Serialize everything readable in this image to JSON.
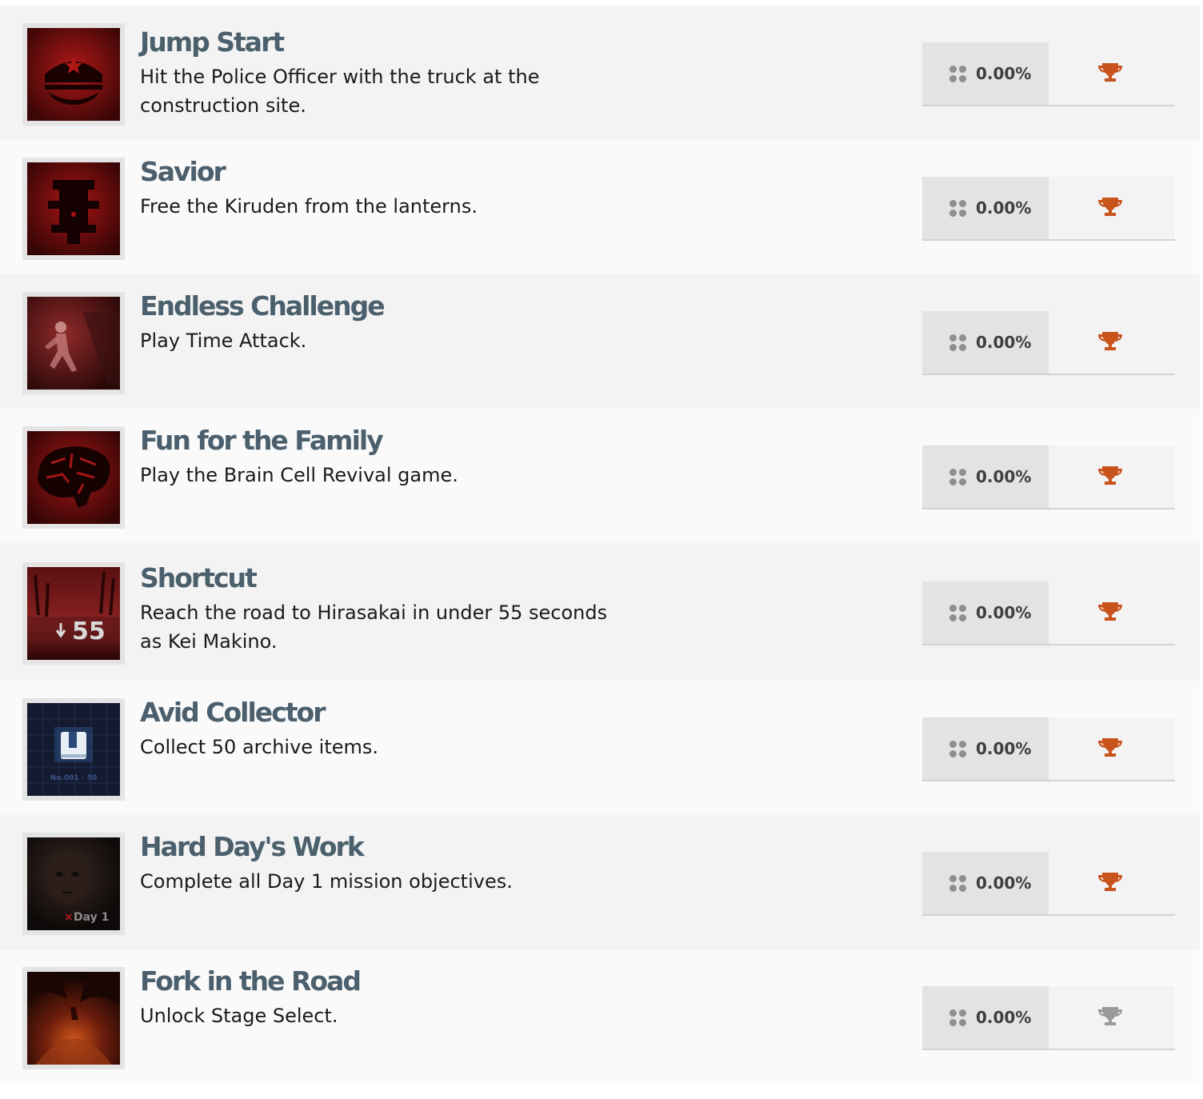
{
  "achievements": [
    {
      "title": "Jump Start",
      "description": "Hit the Police Officer with the truck at the construction site.",
      "percent": "0.00%",
      "trophy_icon": "trophy-icon",
      "trophy_color": "#c8531b",
      "image_icon": "police-cap-icon"
    },
    {
      "title": "Savior",
      "description": "Free the Kiruden from the lanterns.",
      "percent": "0.00%",
      "trophy_icon": "trophy-icon",
      "trophy_color": "#c8531b",
      "image_icon": "shrine-icon"
    },
    {
      "title": "Endless Challenge",
      "description": "Play Time Attack.",
      "percent": "0.00%",
      "trophy_icon": "trophy-icon",
      "trophy_color": "#c8531b",
      "image_icon": "running-figure-icon"
    },
    {
      "title": "Fun for the Family",
      "description": "Play the Brain Cell Revival game.",
      "percent": "0.00%",
      "trophy_icon": "trophy-icon",
      "trophy_color": "#c8531b",
      "image_icon": "brain-icon"
    },
    {
      "title": "Shortcut",
      "description": "Reach the road to Hirasakai in under 55 seconds as Kei Makino.",
      "percent": "0.00%",
      "trophy_icon": "trophy-icon",
      "trophy_color": "#c8531b",
      "image_icon": "timer-55-icon",
      "image_text": "55"
    },
    {
      "title": "Avid Collector",
      "description": "Collect 50 archive items.",
      "percent": "0.00%",
      "trophy_icon": "trophy-icon",
      "trophy_color": "#c8531b",
      "image_icon": "archive-book-icon",
      "image_text": "No.001 - 50"
    },
    {
      "title": "Hard Day's Work",
      "description": "Complete all Day 1 mission objectives.",
      "percent": "0.00%",
      "trophy_icon": "trophy-icon",
      "trophy_color": "#c8531b",
      "image_icon": "face-day1-icon",
      "image_text": "Day 1"
    },
    {
      "title": "Fork in the Road",
      "description": "Unlock Stage Select.",
      "percent": "0.00%",
      "trophy_icon": "trophy-icon",
      "trophy_color": "#9a9a9a",
      "image_icon": "fire-road-icon"
    }
  ]
}
